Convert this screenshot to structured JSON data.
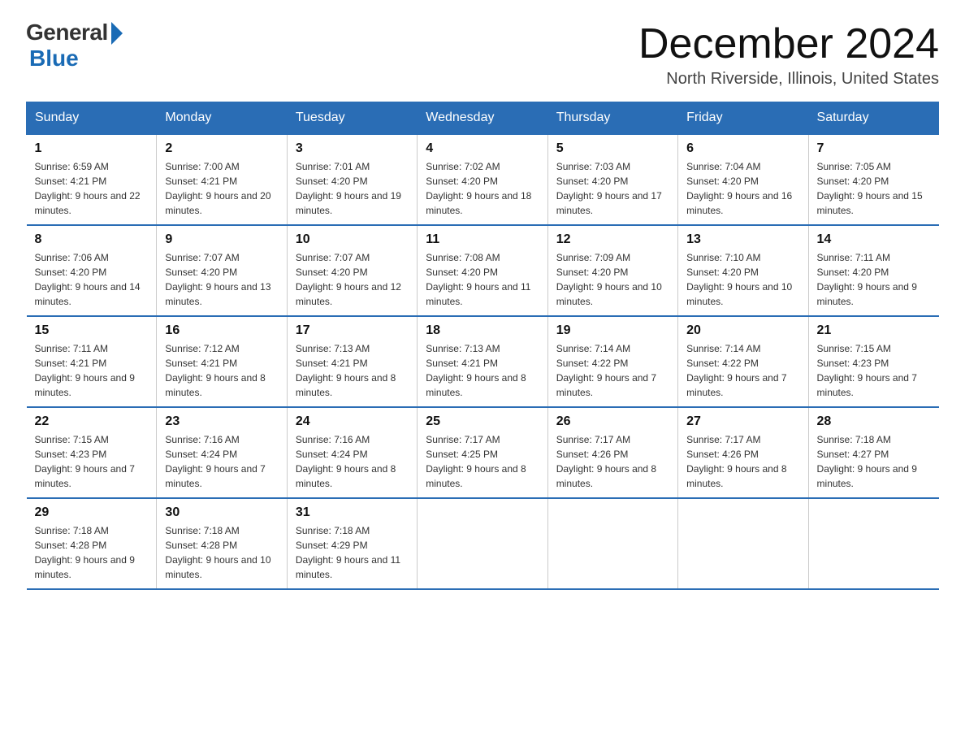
{
  "logo": {
    "general": "General",
    "blue": "Blue"
  },
  "title": "December 2024",
  "subtitle": "North Riverside, Illinois, United States",
  "days_of_week": [
    "Sunday",
    "Monday",
    "Tuesday",
    "Wednesday",
    "Thursday",
    "Friday",
    "Saturday"
  ],
  "weeks": [
    [
      {
        "day": "1",
        "sunrise": "6:59 AM",
        "sunset": "4:21 PM",
        "daylight": "9 hours and 22 minutes."
      },
      {
        "day": "2",
        "sunrise": "7:00 AM",
        "sunset": "4:21 PM",
        "daylight": "9 hours and 20 minutes."
      },
      {
        "day": "3",
        "sunrise": "7:01 AM",
        "sunset": "4:20 PM",
        "daylight": "9 hours and 19 minutes."
      },
      {
        "day": "4",
        "sunrise": "7:02 AM",
        "sunset": "4:20 PM",
        "daylight": "9 hours and 18 minutes."
      },
      {
        "day": "5",
        "sunrise": "7:03 AM",
        "sunset": "4:20 PM",
        "daylight": "9 hours and 17 minutes."
      },
      {
        "day": "6",
        "sunrise": "7:04 AM",
        "sunset": "4:20 PM",
        "daylight": "9 hours and 16 minutes."
      },
      {
        "day": "7",
        "sunrise": "7:05 AM",
        "sunset": "4:20 PM",
        "daylight": "9 hours and 15 minutes."
      }
    ],
    [
      {
        "day": "8",
        "sunrise": "7:06 AM",
        "sunset": "4:20 PM",
        "daylight": "9 hours and 14 minutes."
      },
      {
        "day": "9",
        "sunrise": "7:07 AM",
        "sunset": "4:20 PM",
        "daylight": "9 hours and 13 minutes."
      },
      {
        "day": "10",
        "sunrise": "7:07 AM",
        "sunset": "4:20 PM",
        "daylight": "9 hours and 12 minutes."
      },
      {
        "day": "11",
        "sunrise": "7:08 AM",
        "sunset": "4:20 PM",
        "daylight": "9 hours and 11 minutes."
      },
      {
        "day": "12",
        "sunrise": "7:09 AM",
        "sunset": "4:20 PM",
        "daylight": "9 hours and 10 minutes."
      },
      {
        "day": "13",
        "sunrise": "7:10 AM",
        "sunset": "4:20 PM",
        "daylight": "9 hours and 10 minutes."
      },
      {
        "day": "14",
        "sunrise": "7:11 AM",
        "sunset": "4:20 PM",
        "daylight": "9 hours and 9 minutes."
      }
    ],
    [
      {
        "day": "15",
        "sunrise": "7:11 AM",
        "sunset": "4:21 PM",
        "daylight": "9 hours and 9 minutes."
      },
      {
        "day": "16",
        "sunrise": "7:12 AM",
        "sunset": "4:21 PM",
        "daylight": "9 hours and 8 minutes."
      },
      {
        "day": "17",
        "sunrise": "7:13 AM",
        "sunset": "4:21 PM",
        "daylight": "9 hours and 8 minutes."
      },
      {
        "day": "18",
        "sunrise": "7:13 AM",
        "sunset": "4:21 PM",
        "daylight": "9 hours and 8 minutes."
      },
      {
        "day": "19",
        "sunrise": "7:14 AM",
        "sunset": "4:22 PM",
        "daylight": "9 hours and 7 minutes."
      },
      {
        "day": "20",
        "sunrise": "7:14 AM",
        "sunset": "4:22 PM",
        "daylight": "9 hours and 7 minutes."
      },
      {
        "day": "21",
        "sunrise": "7:15 AM",
        "sunset": "4:23 PM",
        "daylight": "9 hours and 7 minutes."
      }
    ],
    [
      {
        "day": "22",
        "sunrise": "7:15 AM",
        "sunset": "4:23 PM",
        "daylight": "9 hours and 7 minutes."
      },
      {
        "day": "23",
        "sunrise": "7:16 AM",
        "sunset": "4:24 PM",
        "daylight": "9 hours and 7 minutes."
      },
      {
        "day": "24",
        "sunrise": "7:16 AM",
        "sunset": "4:24 PM",
        "daylight": "9 hours and 8 minutes."
      },
      {
        "day": "25",
        "sunrise": "7:17 AM",
        "sunset": "4:25 PM",
        "daylight": "9 hours and 8 minutes."
      },
      {
        "day": "26",
        "sunrise": "7:17 AM",
        "sunset": "4:26 PM",
        "daylight": "9 hours and 8 minutes."
      },
      {
        "day": "27",
        "sunrise": "7:17 AM",
        "sunset": "4:26 PM",
        "daylight": "9 hours and 8 minutes."
      },
      {
        "day": "28",
        "sunrise": "7:18 AM",
        "sunset": "4:27 PM",
        "daylight": "9 hours and 9 minutes."
      }
    ],
    [
      {
        "day": "29",
        "sunrise": "7:18 AM",
        "sunset": "4:28 PM",
        "daylight": "9 hours and 9 minutes."
      },
      {
        "day": "30",
        "sunrise": "7:18 AM",
        "sunset": "4:28 PM",
        "daylight": "9 hours and 10 minutes."
      },
      {
        "day": "31",
        "sunrise": "7:18 AM",
        "sunset": "4:29 PM",
        "daylight": "9 hours and 11 minutes."
      },
      null,
      null,
      null,
      null
    ]
  ],
  "labels": {
    "sunrise": "Sunrise:",
    "sunset": "Sunset:",
    "daylight": "Daylight:"
  }
}
